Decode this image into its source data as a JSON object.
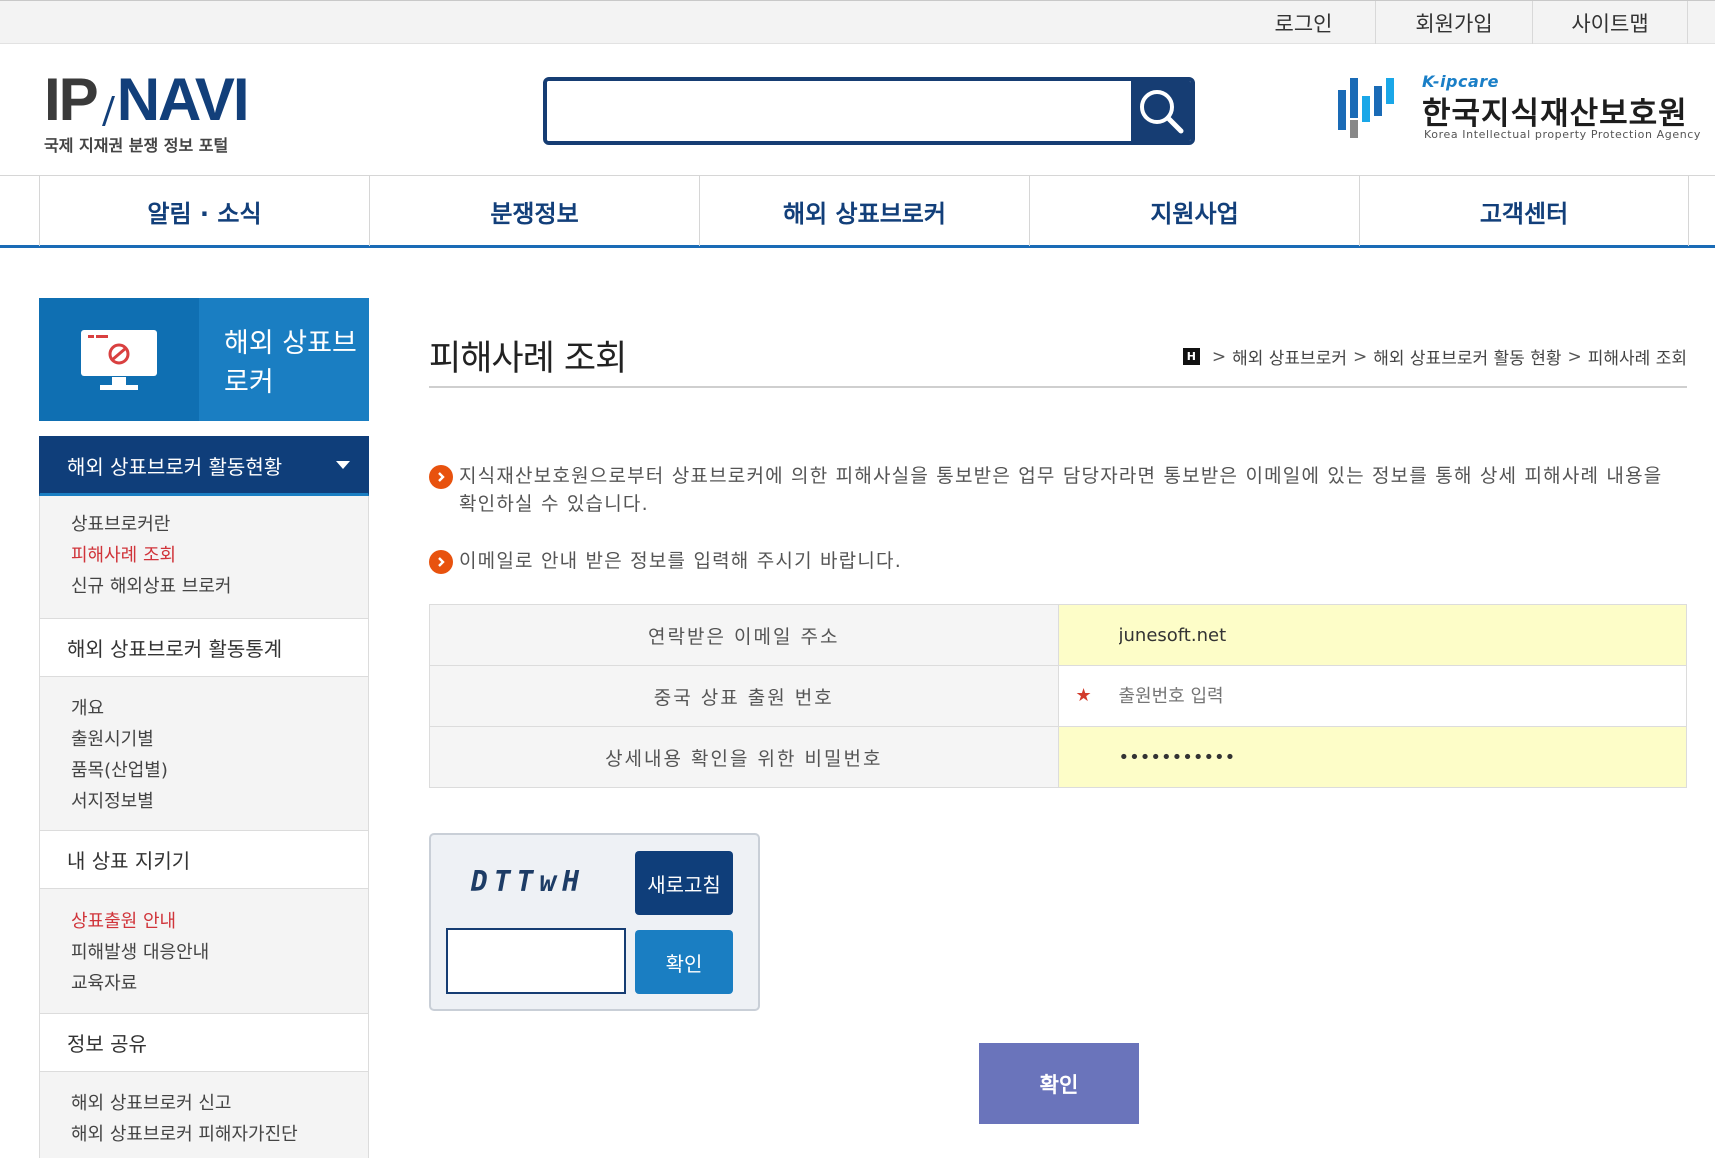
{
  "top_util": {
    "login": "로그인",
    "join": "회원가입",
    "sitemap": "사이트맵"
  },
  "header": {
    "logo_ip": "IP",
    "logo_navi": "NAVI",
    "logo_sub": "국제 지재권 분쟁 정보 포털",
    "search_placeholder": "",
    "agency_kcare": "K-ipcare",
    "agency_name": "한국지식재산보호원",
    "agency_eng": "Korea Intellectual property Protection Agency"
  },
  "gnb": {
    "items": [
      "알림 · 소식",
      "분쟁정보",
      "해외 상표브로커",
      "지원사업",
      "고객센터"
    ]
  },
  "lnb": {
    "banner_title": "해외 상표브로커",
    "sections": [
      {
        "label": "해외 상표브로커 활동현황",
        "items": [
          "상표브로커란",
          "피해사례 조회",
          "신규 해외상표 브로커"
        ]
      },
      {
        "label": "해외 상표브로커 활동통계",
        "items": [
          "개요",
          "출원시기별",
          "품목(산업별)",
          "서지정보별"
        ]
      },
      {
        "label": "내 상표 지키기",
        "items": [
          "상표출원 안내",
          "피해발생 대응안내",
          "교육자료"
        ]
      },
      {
        "label": "정보 공유",
        "items": [
          "해외 상표브로커 신고",
          "해외 상표브로커 피해자가진단"
        ]
      }
    ]
  },
  "content": {
    "page_title": "피해사례 조회",
    "breadcrumb": {
      "home": "H",
      "items": [
        "해외 상표브로커",
        "해외 상표브로커 활동 현황",
        "피해사례 조회"
      ]
    },
    "notice1": "지식재산보호원으로부터 상표브로커에 의한 피해사실을 통보받은 업무 담당자라면 통보받은 이메일에 있는 정보를 통해 상세 피해사례 내용을 확인하실 수 있습니다.",
    "notice2": "이메일로 안내 받은 정보를 입력해 주시기 바랍니다."
  },
  "form": {
    "email_label": "연락받은 이메일 주소",
    "email_value": "junesoft.net",
    "app_no_label": "중국 상표 출원 번호",
    "app_no_placeholder": "출원번호 입력",
    "required_mark": "★",
    "password_label": "상세내용 확인을 위한 비밀번호",
    "password_value": "•••••••••••"
  },
  "captcha": {
    "code": "DTTwH",
    "refresh_label": "새로고침",
    "confirm_label": "확인",
    "input_value": ""
  },
  "submit_label": "확인",
  "colors": {
    "navy": "#0f3e7a",
    "blue": "#1a7ec2",
    "orange_bullet": "#e8520e",
    "highlight_yellow": "#fdfdc8",
    "submit": "#6a74bb",
    "red_text": "#d0343a"
  }
}
